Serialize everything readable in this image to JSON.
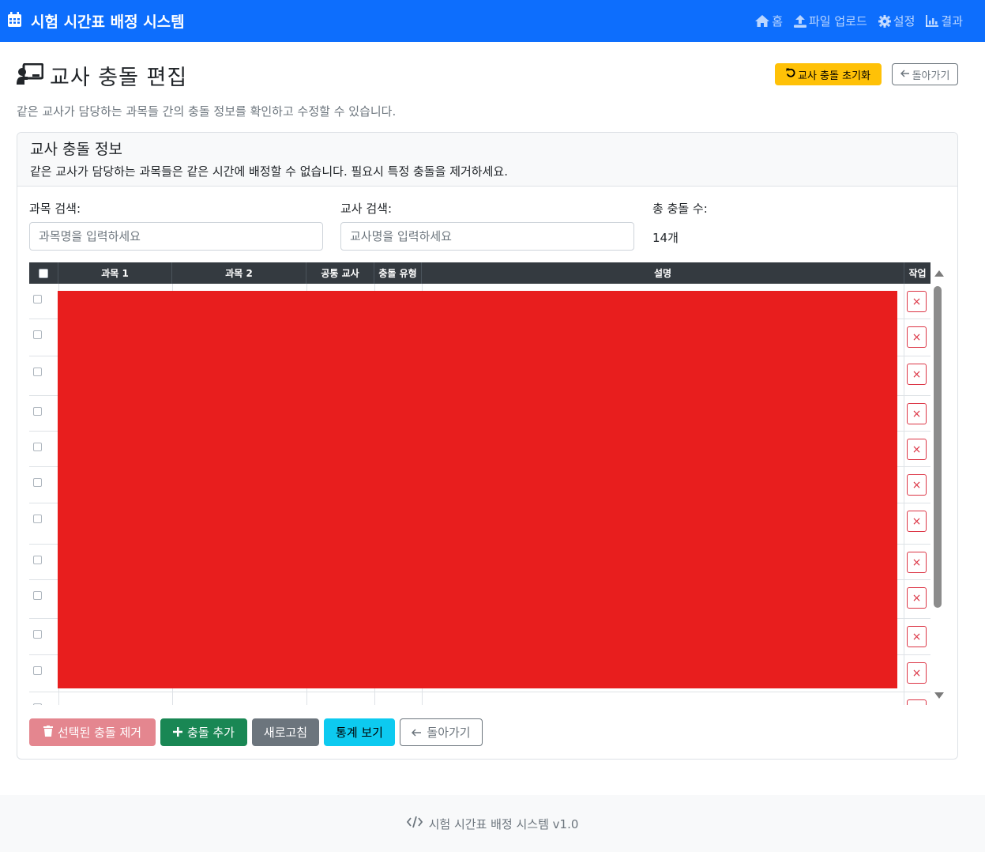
{
  "navbar": {
    "brand": "시험 시간표 배정 시스템",
    "links": [
      {
        "label": "홈",
        "icon": "home-icon"
      },
      {
        "label": "파일 업로드",
        "icon": "upload-icon"
      },
      {
        "label": "설정",
        "icon": "gear-icon"
      },
      {
        "label": "결과",
        "icon": "chart-icon"
      }
    ]
  },
  "page": {
    "title": "교사 충돌 편집",
    "subtitle": "같은 교사가 담당하는 과목들 간의 충돌 정보를 확인하고 수정할 수 있습니다.",
    "reset_button": "교사 충돌 초기화",
    "back_button": "돌아가기"
  },
  "card": {
    "title": "교사 충돌 정보",
    "subtitle": "같은 교사가 담당하는 과목들은 같은 시간에 배정할 수 없습니다. 필요시 특정 충돌을 제거하세요.",
    "subject_search_label": "과목 검색:",
    "subject_search_placeholder": "과목명을 입력하세요",
    "teacher_search_label": "교사 검색:",
    "teacher_search_placeholder": "교사명을 입력하세요",
    "total_label": "총 충돌 수:",
    "total_value": "14개"
  },
  "table": {
    "headers": {
      "subject1": "과목 1",
      "subject2": "과목 2",
      "teacher": "공통 교사",
      "type": "충돌 유형",
      "desc": "설명",
      "action": "작업"
    },
    "delete_symbol": "×"
  },
  "actions": {
    "remove_selected": "선택된 충돌 제거",
    "add": "충돌 추가",
    "refresh": "새로고침",
    "stats": "통계 보기",
    "back": "돌아가기"
  },
  "footer": {
    "text": "시험 시간표 배정 시스템 v1.0"
  },
  "colors": {
    "primary": "#0d6efd",
    "warning": "#ffc107",
    "danger": "#dc3545",
    "success": "#198754",
    "info": "#0dcaf0",
    "redaction": "#e81e1e"
  }
}
